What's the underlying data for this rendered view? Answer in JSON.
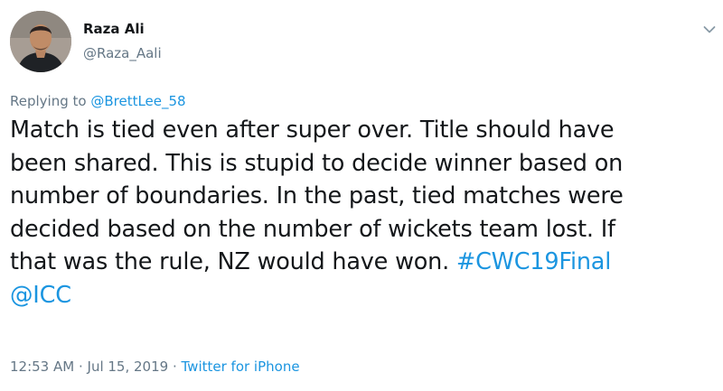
{
  "author": {
    "name": "Raza Ali",
    "handle": "@Raza_Aali"
  },
  "reply": {
    "prefix": "Replying to ",
    "mention": "@BrettLee_58"
  },
  "tweet": {
    "lines": [
      "Match is tied even after super over. Title should have",
      "been shared. This is stupid to decide winner based on",
      "number of boundaries. In the past, tied matches were",
      "decided based on the number of wickets team lost. If",
      "that was the rule, NZ would have won. "
    ],
    "hashtag": "#CWC19Final",
    "mention": "@ICC"
  },
  "meta": {
    "time": "12:53 AM",
    "separator1": " · ",
    "date": "Jul 15, 2019",
    "separator2": " · ",
    "source": "Twitter for iPhone"
  },
  "icons": {
    "avatar": "avatar-photo",
    "menu": "chevron-down-icon"
  },
  "colors": {
    "link": "#1b95e0",
    "secondary_text": "#657786",
    "primary_text": "#14171a"
  }
}
